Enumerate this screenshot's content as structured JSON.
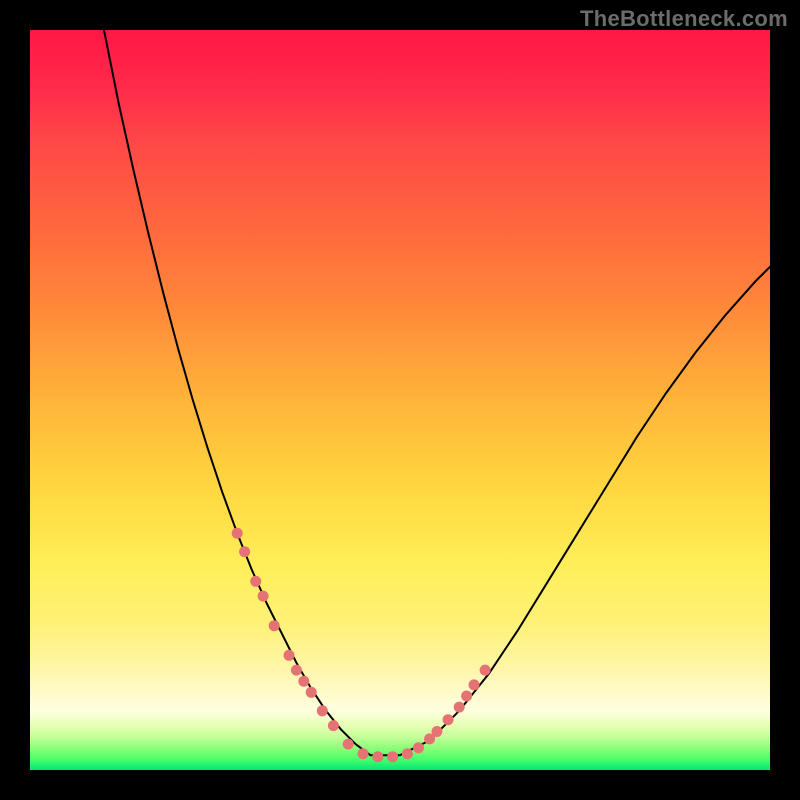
{
  "watermark": "TheBottleneck.com",
  "chart_data": {
    "type": "line",
    "title": "",
    "xlabel": "",
    "ylabel": "",
    "x_range": [
      0,
      100
    ],
    "y_range": [
      0,
      100
    ],
    "series": [
      {
        "name": "curve",
        "stroke": "#000000",
        "stroke_width": 2,
        "x": [
          10,
          12,
          14,
          16,
          18,
          20,
          22,
          24,
          26,
          28,
          30,
          32,
          34,
          36,
          38,
          40,
          42,
          44,
          46,
          50,
          54,
          58,
          62,
          66,
          70,
          74,
          78,
          82,
          86,
          90,
          94,
          98,
          100
        ],
        "y": [
          100,
          90,
          81,
          72.5,
          64.5,
          57,
          50,
          43.5,
          37.5,
          32,
          27,
          22.5,
          18.5,
          14.5,
          11,
          8,
          5.5,
          3.5,
          2,
          2,
          4,
          8,
          13,
          19,
          25.5,
          32,
          38.5,
          45,
          51,
          56.5,
          61.5,
          66,
          68
        ]
      },
      {
        "name": "highlight-dots",
        "stroke": "#e57373",
        "stroke_width": 11,
        "dotted": true,
        "x": [
          28,
          29,
          30.5,
          31.5,
          33,
          35,
          36,
          37,
          38,
          39.5,
          41,
          43,
          45,
          47,
          49,
          51,
          52.5,
          54,
          55,
          56.5,
          58,
          59,
          60,
          61.5
        ],
        "y": [
          32,
          29.5,
          25.5,
          23.5,
          19.5,
          15.5,
          13.5,
          12,
          10.5,
          8,
          6,
          3.5,
          2.2,
          1.8,
          1.8,
          2.2,
          3,
          4.2,
          5.2,
          6.8,
          8.5,
          10,
          11.5,
          13.5
        ]
      }
    ],
    "background_gradient": {
      "top": "#ff1744",
      "mid": "#ffd740",
      "bottom": "#00e676"
    }
  }
}
